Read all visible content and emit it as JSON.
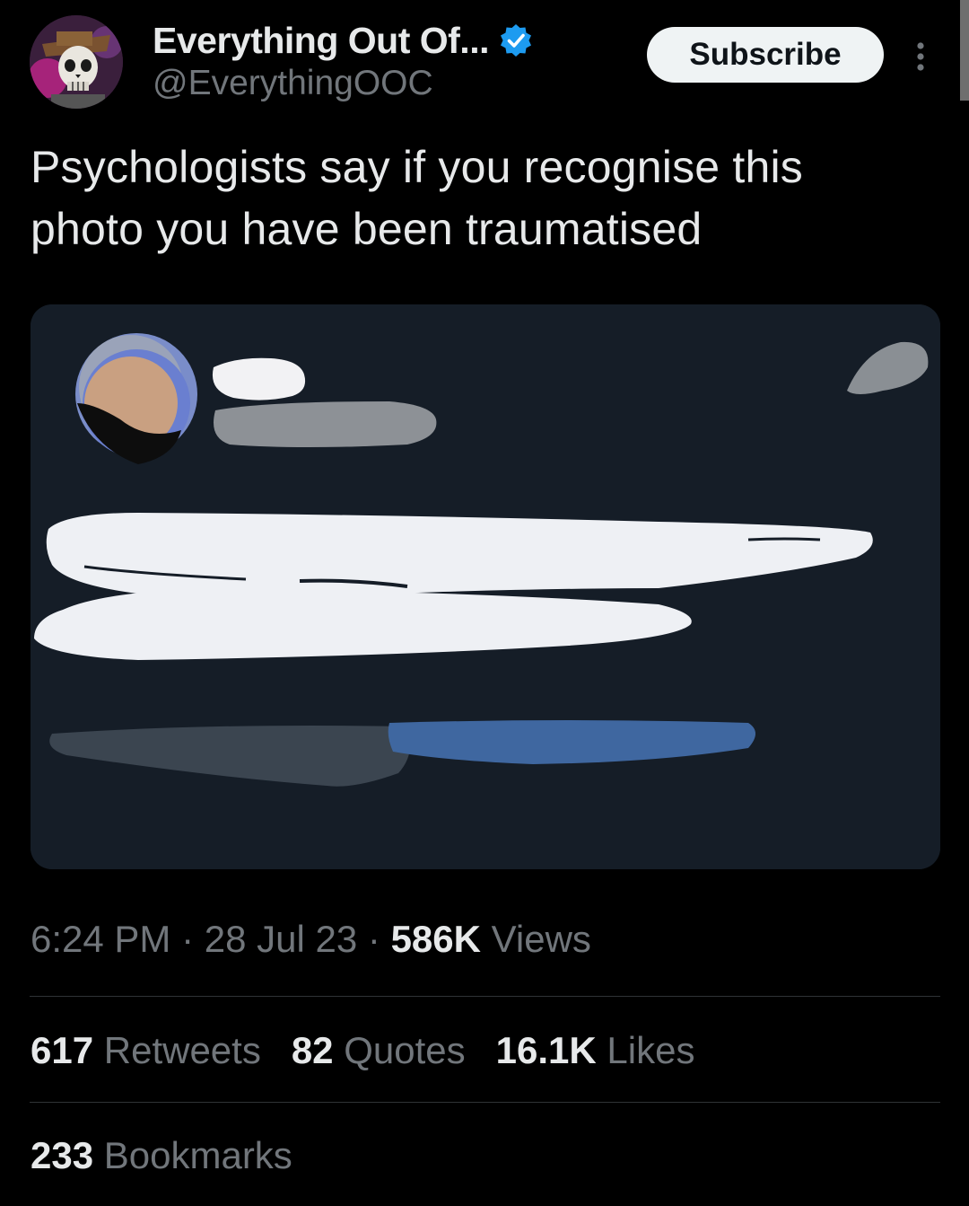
{
  "author": {
    "display_name": "Everything Out Of...",
    "handle": "@EverythingOOC",
    "verified_icon": "verified-badge-icon",
    "avatar_icon": "skull-avatar-icon"
  },
  "actions": {
    "subscribe_label": "Subscribe",
    "more_icon": "more-vertical-icon"
  },
  "tweet": {
    "text": "Psychologists say if you recognise this photo you have been traumatised"
  },
  "meta": {
    "time": "6:24 PM",
    "separator": "·",
    "date": "28 Jul 23",
    "views_count": "586K",
    "views_label": "Views"
  },
  "stats": {
    "retweets_count": "617",
    "retweets_label": "Retweets",
    "quotes_count": "82",
    "quotes_label": "Quotes",
    "likes_count": "16.1K",
    "likes_label": "Likes",
    "bookmarks_count": "233",
    "bookmarks_label": "Bookmarks"
  },
  "colors": {
    "background": "#000000",
    "primary_text": "#e7e9ea",
    "secondary_text": "#71767b",
    "verified": "#1d9bf0",
    "divider": "#2f3336",
    "media_background": "#151d27"
  }
}
